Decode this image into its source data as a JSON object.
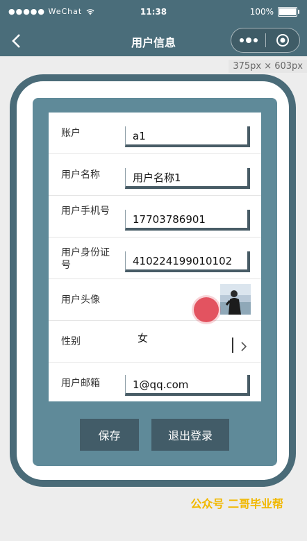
{
  "status_bar": {
    "carrier": "●●●●● WeChat",
    "time": "11:38",
    "battery": "100%"
  },
  "nav": {
    "title": "用户信息"
  },
  "size_tag": "375px × 603px",
  "form": {
    "account_label": "账户",
    "account_value": "a1",
    "username_label": "用户名称",
    "username_value": "用户名称1",
    "phone_label": "用户手机号",
    "phone_value": "17703786901",
    "idcard_label": "用户身份证号",
    "idcard_value": "410224199010102",
    "avatar_label": "用户头像",
    "gender_label": "性别",
    "gender_value": "女",
    "email_label": "用户邮箱",
    "email_value": "1@qq.com"
  },
  "buttons": {
    "save": "保存",
    "logout": "退出登录"
  },
  "watermark": "公众号 二哥毕业帮",
  "colors": {
    "nav_bg": "#4a6d7a",
    "panel_bg": "#5f8a99",
    "button_bg": "#425c68",
    "watermark": "#f1b800"
  }
}
